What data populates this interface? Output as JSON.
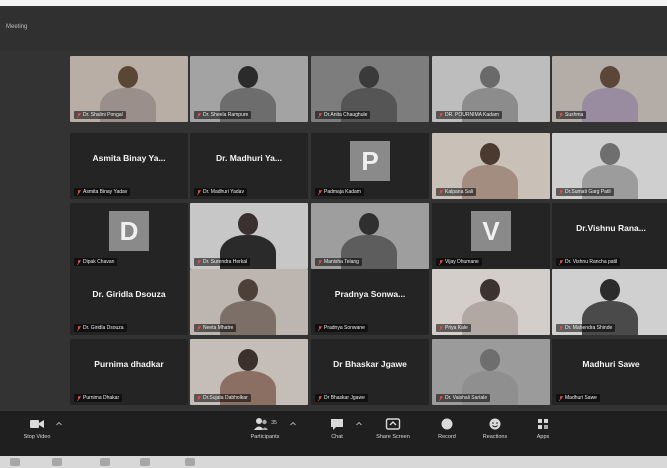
{
  "window": {
    "title": "Meeting"
  },
  "tiles": [
    {
      "type": "video",
      "name": "Dr. Shalini Pongal",
      "head_color": "#5a4634",
      "body_color": "#9a8f8a",
      "bg": "#b8aea6"
    },
    {
      "type": "video",
      "name": "Dr. Sheela Rampure",
      "head_color": "#2b2b2b",
      "body_color": "#6d6d6d",
      "bg": "#a3a3a3"
    },
    {
      "type": "video",
      "name": "Dr.Anita Chaughule",
      "head_color": "#3a3a3a",
      "body_color": "#555555",
      "bg": "#7d7d7d"
    },
    {
      "type": "video",
      "name": "DR. POURNIMA Kadam",
      "head_color": "#6a6a6a",
      "body_color": "#8c8c8c",
      "bg": "#bdbdbd"
    },
    {
      "type": "video",
      "name": "Sushma",
      "head_color": "#5b463a",
      "body_color": "#9a8ca0",
      "bg": "#b4aca7"
    },
    {
      "type": "name",
      "display": "Asmita Binay Ya...",
      "name": "Asmita Binay Yadav"
    },
    {
      "type": "name",
      "display": "Dr. Madhuri Ya...",
      "name": "Dr. Madhuri Yadav"
    },
    {
      "type": "initial",
      "initial": "P",
      "name": "Padmaja Kadam"
    },
    {
      "type": "video",
      "name": "Kalpana Sali",
      "head_color": "#4a3a30",
      "body_color": "#a38d80",
      "bg": "#c9c0b8"
    },
    {
      "type": "video",
      "name": "Dr.Sumati Garg Patil",
      "head_color": "#6f6f6f",
      "body_color": "#9c9c9c",
      "bg": "#cfcfcf"
    },
    {
      "type": "initial",
      "initial": "D",
      "name": "Dipak Chavan"
    },
    {
      "type": "video",
      "name": "Dr. Surendra Herkal",
      "head_color": "#3a3030",
      "body_color": "#2a2a2a",
      "bg": "#c7c7c7"
    },
    {
      "type": "video",
      "name": "Manisha Telang",
      "head_color": "#2f2f2f",
      "body_color": "#5d5d5d",
      "bg": "#9e9e9e"
    },
    {
      "type": "initial",
      "initial": "V",
      "name": "Vijay Dhumane"
    },
    {
      "type": "name",
      "display": "Dr.Vishnu Rana...",
      "name": "Dr. Vishnu Rancha patil"
    },
    {
      "type": "name",
      "display": "Dr. Giridla Dsouza",
      "name": "Dr. Giridla Dsouza"
    },
    {
      "type": "video",
      "name": "Neeta Mhatre",
      "head_color": "#4d4038",
      "body_color": "#7c6f68",
      "bg": "#bdb5b0"
    },
    {
      "type": "name",
      "display": "Pradnya Sonwa...",
      "name": "Pradnya Sonwane"
    },
    {
      "type": "video",
      "name": "Priya Kale",
      "head_color": "#3c3330",
      "body_color": "#b1a8a3",
      "bg": "#d3cec9"
    },
    {
      "type": "video",
      "name": "Dr. Mahendra Shinde",
      "head_color": "#2b2b2b",
      "body_color": "#4a4a4a",
      "bg": "#d0d0d0"
    },
    {
      "type": "name",
      "display": "Purnima dhadkar",
      "name": "Purnima Dhakar"
    },
    {
      "type": "video",
      "name": "Dr.Sujata Dabholkar",
      "head_color": "#3b302b",
      "body_color": "#8c6f63",
      "bg": "#c5beb8"
    },
    {
      "type": "name",
      "display": "Dr Bhaskar Jgawe",
      "name": "Dr Bhaskar Jgawe"
    },
    {
      "type": "video",
      "name": "Dr. Vaishali Sartale",
      "head_color": "#6e6e6e",
      "body_color": "#8f8f8f",
      "bg": "#9b9b9b"
    },
    {
      "type": "name",
      "display": "Madhuri Sawe",
      "name": "Madhuri Sawe"
    }
  ],
  "toolbar": {
    "stop_video": "Stop Video",
    "participants": "Participants",
    "participant_count": "35",
    "chat": "Chat",
    "share_screen": "Share Screen",
    "record": "Record",
    "reactions": "Reactions",
    "apps": "Apps"
  },
  "colors": {
    "screen_bg": "#333333",
    "tile_bg": "#242424",
    "toolbar_bg": "#1f1f1f",
    "initial_bg": "#8a8a8a"
  }
}
